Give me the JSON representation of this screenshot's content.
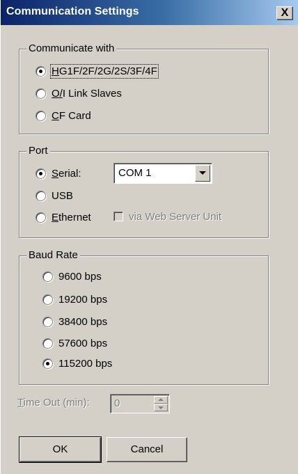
{
  "window": {
    "title": "Communication Settings",
    "close_label": "X"
  },
  "communicate_with": {
    "label": "Communicate with",
    "options": [
      {
        "label": "HG1F/2F/2G/2S/3F/4F",
        "checked": true
      },
      {
        "label": "O/I Link Slaves",
        "checked": false
      },
      {
        "label": "CF Card",
        "checked": false
      }
    ]
  },
  "port": {
    "label": "Port",
    "options": [
      {
        "label": "Serial:",
        "checked": true
      },
      {
        "label": "USB",
        "checked": false
      },
      {
        "label": "Ethernet",
        "checked": false
      }
    ],
    "com_port_value": "COM 1",
    "web_server_label": "via Web Server Unit"
  },
  "baud_rate": {
    "label": "Baud Rate",
    "options": [
      {
        "label": "9600 bps",
        "checked": false
      },
      {
        "label": "19200 bps",
        "checked": false
      },
      {
        "label": "38400 bps",
        "checked": false
      },
      {
        "label": "57600 bps",
        "checked": false
      },
      {
        "label": "115200 bps",
        "checked": true
      }
    ]
  },
  "timeout": {
    "label": "Time Out (min):",
    "value": "0"
  },
  "buttons": {
    "ok_label": "OK",
    "cancel_label": "Cancel"
  }
}
